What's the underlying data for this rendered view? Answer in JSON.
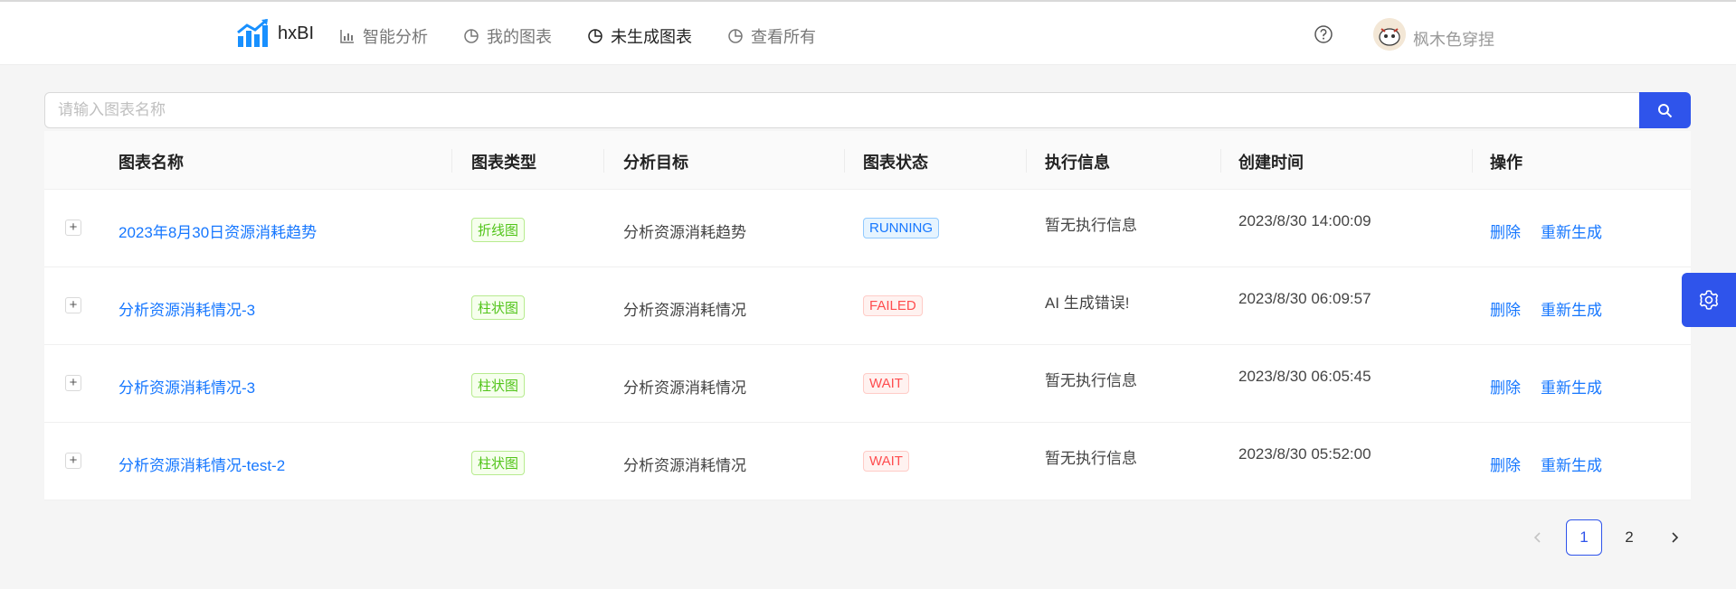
{
  "header": {
    "brand": "hxBI",
    "nav": [
      {
        "label": "智能分析",
        "icon": "bar-chart-icon"
      },
      {
        "label": "我的图表",
        "icon": "pie-chart-icon"
      },
      {
        "label": "未生成图表",
        "icon": "pie-chart-icon"
      },
      {
        "label": "查看所有",
        "icon": "pie-chart-icon"
      }
    ],
    "active_nav": "未生成图表",
    "username": "枫木色穿捏"
  },
  "search": {
    "placeholder": "请输入图表名称",
    "value": ""
  },
  "table": {
    "columns": [
      "图表名称",
      "图表类型",
      "分析目标",
      "图表状态",
      "执行信息",
      "创建时间",
      "操作"
    ],
    "rows": [
      {
        "name": "2023年8月30日资源消耗趋势",
        "type": "折线图",
        "goal": "分析资源消耗趋势",
        "status": "RUNNING",
        "exec": "暂无执行信息",
        "time": "2023/8/30 14:00:09",
        "delete": "删除",
        "regen": "重新生成"
      },
      {
        "name": "分析资源消耗情况-3",
        "type": "柱状图",
        "goal": "分析资源消耗情况",
        "status": "FAILED",
        "exec": "AI 生成错误!",
        "time": "2023/8/30 06:09:57",
        "delete": "删除",
        "regen": "重新生成"
      },
      {
        "name": "分析资源消耗情况-3",
        "type": "柱状图",
        "goal": "分析资源消耗情况",
        "status": "WAIT",
        "exec": "暂无执行信息",
        "time": "2023/8/30 06:05:45",
        "delete": "删除",
        "regen": "重新生成"
      },
      {
        "name": "分析资源消耗情况-test-2",
        "type": "柱状图",
        "goal": "分析资源消耗情况",
        "status": "WAIT",
        "exec": "暂无执行信息",
        "time": "2023/8/30 05:52:00",
        "delete": "删除",
        "regen": "重新生成"
      }
    ],
    "expand_symbol": "+"
  },
  "pagination": {
    "pages": [
      "1",
      "2"
    ],
    "current": "1"
  },
  "colors": {
    "primary": "#2f54eb",
    "link": "#1677ff",
    "tag_green": "#52c41a",
    "status_red": "#ff4d4f"
  }
}
